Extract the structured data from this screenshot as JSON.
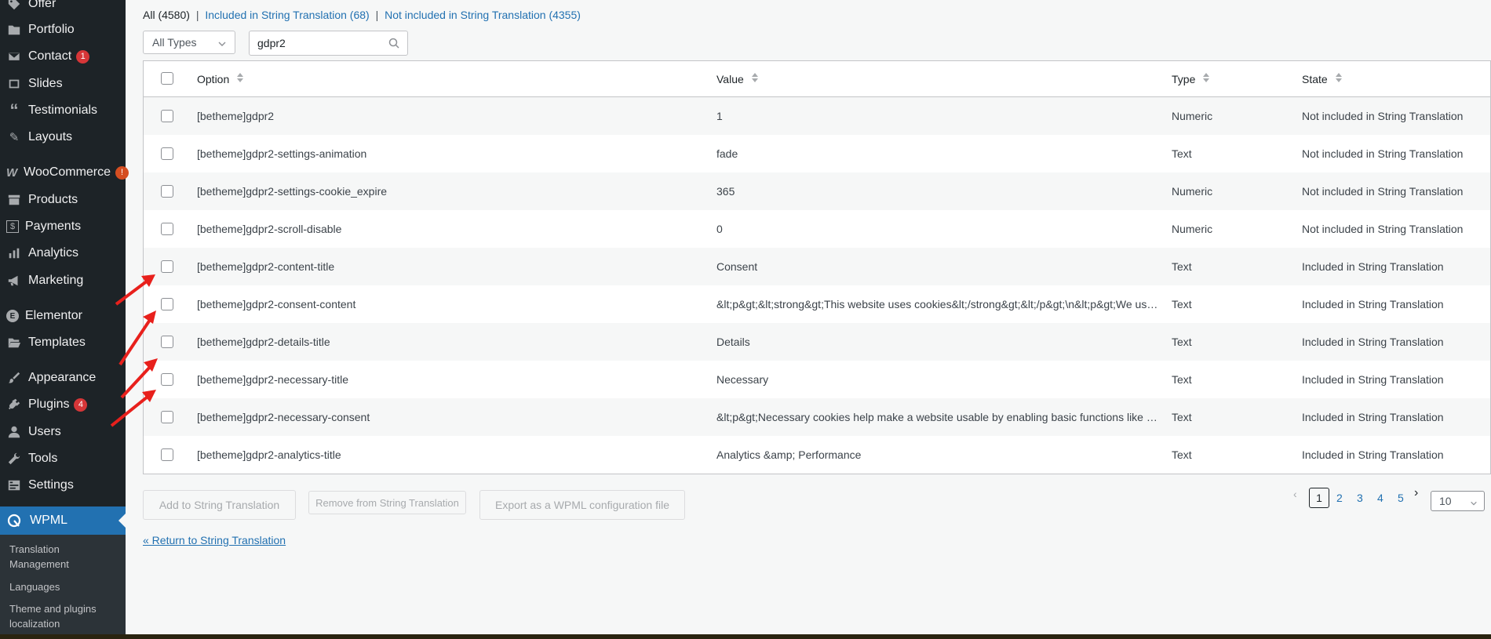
{
  "sidebar": {
    "items": [
      {
        "label": "Offer",
        "icon": "tag-icon"
      },
      {
        "label": "Portfolio",
        "icon": "folder-icon"
      },
      {
        "label": "Contact",
        "icon": "envelope-icon",
        "badge": "1"
      },
      {
        "label": "Slides",
        "icon": "slides-icon"
      },
      {
        "label": "Testimonials",
        "icon": "quote-icon"
      },
      {
        "label": "Layouts",
        "icon": "pencil-icon"
      },
      {
        "label": "WooCommerce",
        "icon": "woocommerce-icon",
        "badge": "!"
      },
      {
        "label": "Products",
        "icon": "archive-icon"
      },
      {
        "label": "Payments",
        "icon": "dollar-icon"
      },
      {
        "label": "Analytics",
        "icon": "bar-chart-icon"
      },
      {
        "label": "Marketing",
        "icon": "megaphone-icon"
      },
      {
        "label": "Elementor",
        "icon": "elementor-icon"
      },
      {
        "label": "Templates",
        "icon": "folder-open-icon"
      },
      {
        "label": "Appearance",
        "icon": "paintbrush-icon"
      },
      {
        "label": "Plugins",
        "icon": "plug-icon",
        "badge": "4"
      },
      {
        "label": "Users",
        "icon": "user-icon"
      },
      {
        "label": "Tools",
        "icon": "wrench-icon"
      },
      {
        "label": "Settings",
        "icon": "settings-icon"
      }
    ],
    "current": {
      "label": "WPML",
      "icon": "wpml-icon"
    },
    "submenu": [
      "Translation Management",
      "Languages",
      "Theme and plugins localization"
    ]
  },
  "filters": {
    "all": "All (4580)",
    "sep": "|",
    "included": "Included in String Translation (68)",
    "not_included": "Not included in String Translation (4355)"
  },
  "type_select": {
    "value": "All Types"
  },
  "search": {
    "value": "gdpr2"
  },
  "table": {
    "headers": {
      "option": "Option",
      "value": "Value",
      "type": "Type",
      "state": "State"
    },
    "rows": [
      {
        "option": "[betheme]gdpr2",
        "value": "1",
        "type": "Numeric",
        "state": "Not included in String Translation"
      },
      {
        "option": "[betheme]gdpr2-settings-animation",
        "value": "fade",
        "type": "Text",
        "state": "Not included in String Translation"
      },
      {
        "option": "[betheme]gdpr2-settings-cookie_expire",
        "value": "365",
        "type": "Numeric",
        "state": "Not included in String Translation"
      },
      {
        "option": "[betheme]gdpr2-scroll-disable",
        "value": "0",
        "type": "Numeric",
        "state": "Not included in String Translation"
      },
      {
        "option": "[betheme]gdpr2-content-title",
        "value": "Consent",
        "type": "Text",
        "state": "Included in String Translation"
      },
      {
        "option": "[betheme]gdpr2-consent-content",
        "value": "&lt;p&gt;&lt;strong&gt;This website uses cookies&lt;/strong&gt;&lt;/p&gt;\\n&lt;p&gt;We use cookies",
        "type": "Text",
        "state": "Included in String Translation"
      },
      {
        "option": "[betheme]gdpr2-details-title",
        "value": "Details",
        "type": "Text",
        "state": "Included in String Translation"
      },
      {
        "option": "[betheme]gdpr2-necessary-title",
        "value": "Necessary",
        "type": "Text",
        "state": "Included in String Translation"
      },
      {
        "option": "[betheme]gdpr2-necessary-consent",
        "value": "&lt;p&gt;Necessary cookies help make a website usable by enabling basic functions like page",
        "type": "Text",
        "state": "Included in String Translation"
      },
      {
        "option": "[betheme]gdpr2-analytics-title",
        "value": "Analytics &amp; Performance",
        "type": "Text",
        "state": "Included in String Translation"
      }
    ]
  },
  "actions": {
    "add": "Add to String Translation",
    "remove": "Remove from String Translation",
    "export": "Export as a WPML configuration file"
  },
  "pagination": {
    "prev": "‹",
    "current": "1",
    "pages": [
      "2",
      "3",
      "4",
      "5"
    ],
    "next": "›",
    "per_page": "10"
  },
  "return_link": "« Return to String Translation",
  "colors": {
    "accent": "#2271b1",
    "sidebar": "#1d2327",
    "annotation_arrow": "#e8201c"
  }
}
